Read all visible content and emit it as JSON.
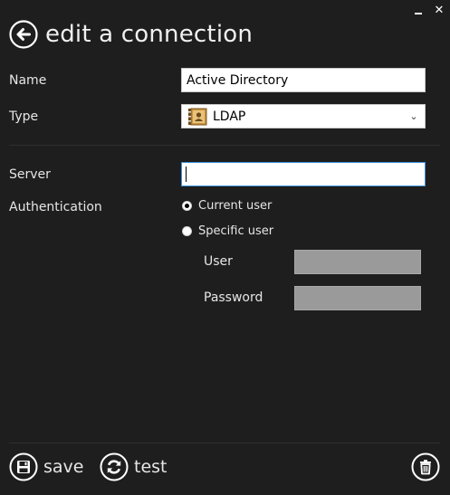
{
  "window": {
    "minimize_label": "minimize",
    "close_label": "close",
    "close_glyph": "✕"
  },
  "header": {
    "title": "edit a connection",
    "back_icon": "arrow-left-circle-icon"
  },
  "form": {
    "name": {
      "label": "Name",
      "value": "Active Directory"
    },
    "type": {
      "label": "Type",
      "value": "LDAP",
      "icon": "ldap-address-book-icon"
    },
    "server": {
      "label": "Server",
      "value": ""
    },
    "authentication": {
      "label": "Authentication",
      "options": [
        {
          "label": "Current user",
          "selected": true
        },
        {
          "label": "Specific user",
          "selected": false
        }
      ],
      "user": {
        "label": "User",
        "value": "",
        "enabled": false
      },
      "password": {
        "label": "Password",
        "value": "",
        "enabled": false
      }
    }
  },
  "actions": {
    "save_label": "save",
    "save_icon": "floppy-disk-icon",
    "test_label": "test",
    "test_icon": "refresh-icon",
    "delete_icon": "trash-icon"
  },
  "colors": {
    "background": "#1e1e1e",
    "text": "#e6e6e6",
    "focus_border": "#3c8fd6",
    "disabled_input": "#9a9a9a"
  }
}
